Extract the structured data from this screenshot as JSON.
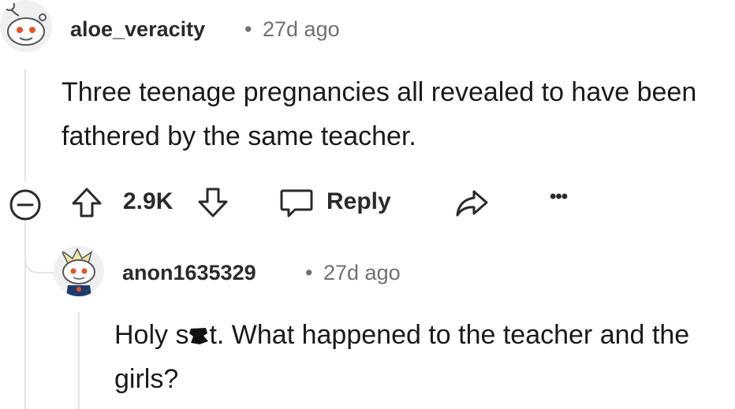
{
  "comments": [
    {
      "username": "aloe_veracity",
      "separator": "•",
      "time": "27d ago",
      "body": "Three teenage pregnancies all revealed to have been fathered by the same teacher."
    },
    {
      "username": "anon1635329",
      "separator": "•",
      "time": "27d ago",
      "body_before": "Holy s",
      "body_after": "t. What happened to the teacher and the girls?"
    }
  ],
  "actions": {
    "collapse_icon": "minus-circle-icon",
    "upvote_icon": "arrow-up-icon",
    "vote_count": "2.9K",
    "downvote_icon": "arrow-down-icon",
    "reply_icon": "speech-bubble-icon",
    "reply_label": "Reply",
    "share_icon": "share-arrow-icon",
    "more_label": "•••"
  },
  "colors": {
    "text": "#1c1c1c",
    "meta": "#707070",
    "thread_line": "#e5e5e5",
    "avatar_accent": "#e8532a"
  }
}
